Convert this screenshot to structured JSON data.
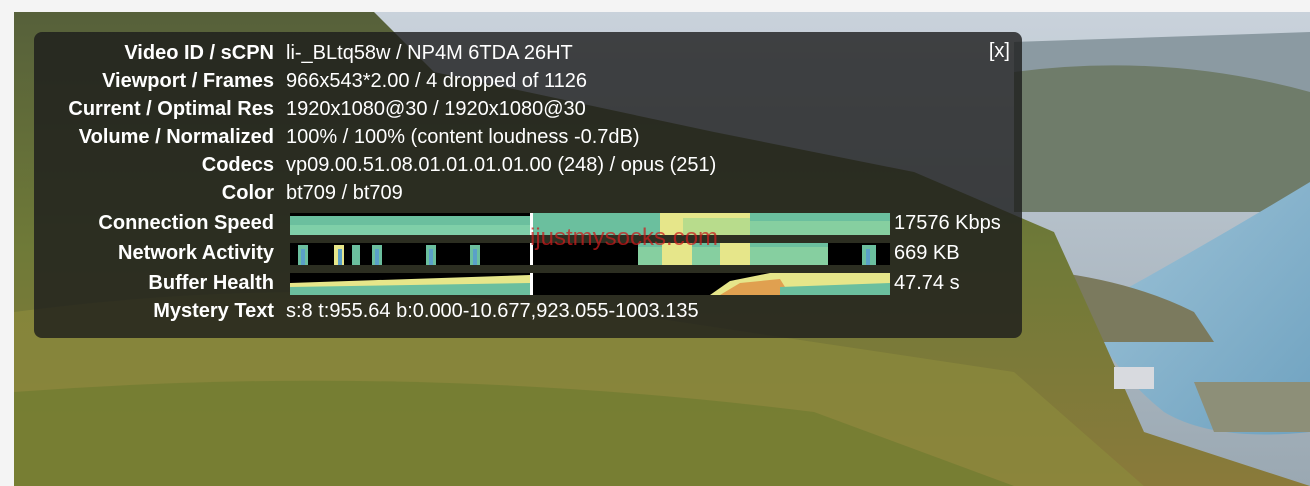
{
  "overlay": {
    "close_label": "[x]",
    "rows": [
      {
        "label": "Video ID / sCPN",
        "value": "li-_BLtq58w / NP4M 6TDA 26HT"
      },
      {
        "label": "Viewport / Frames",
        "value": "966x543*2.00 / 4 dropped of 1126"
      },
      {
        "label": "Current / Optimal Res",
        "value": "1920x1080@30 / 1920x1080@30"
      },
      {
        "label": "Volume / Normalized",
        "value": "100% / 100% (content loudness -0.7dB)"
      },
      {
        "label": "Codecs",
        "value": "vp09.00.51.08.01.01.01.01.00 (248) / opus (251)"
      },
      {
        "label": "Color",
        "value": "bt709 / bt709"
      }
    ],
    "graphs": [
      {
        "label": "Connection Speed",
        "value": "17576 Kbps"
      },
      {
        "label": "Network Activity",
        "value": "669 KB"
      },
      {
        "label": "Buffer Health",
        "value": "47.74 s"
      }
    ],
    "mystery": {
      "label": "Mystery Text",
      "value": "s:8 t:955.64 b:0.000-10.677,923.055-1003.135"
    }
  },
  "watermark": "ijustmysocks.com",
  "colors": {
    "panel_bg": "#1c1c1c",
    "graph_teal": "#6bbf9e",
    "graph_yellow": "#e6e68a",
    "graph_orange": "#e0a050",
    "graph_blue": "#5aa0c8"
  }
}
